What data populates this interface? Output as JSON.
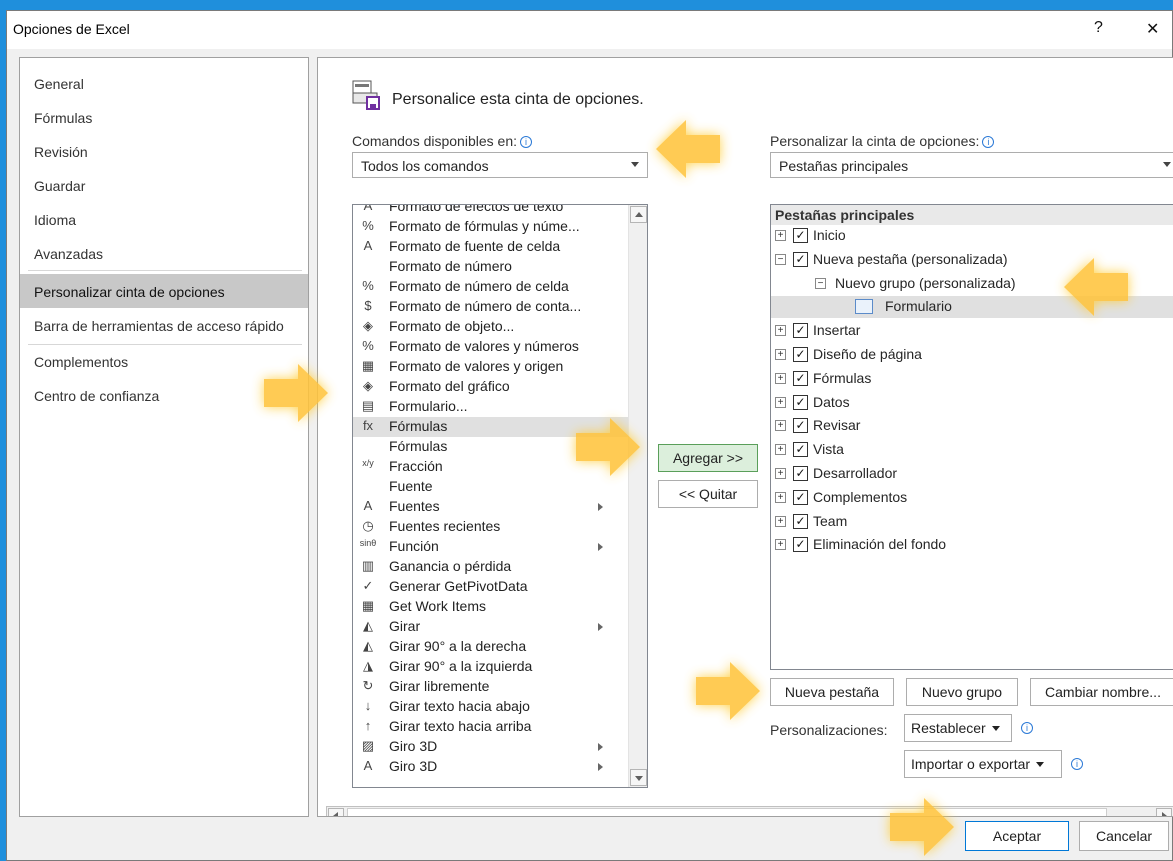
{
  "window": {
    "title": "Opciones de Excel",
    "help": "?",
    "close": "✕"
  },
  "sidebar": {
    "items": [
      {
        "label": "General"
      },
      {
        "label": "Fórmulas"
      },
      {
        "label": "Revisión"
      },
      {
        "label": "Guardar"
      },
      {
        "label": "Idioma"
      },
      {
        "label": "Avanzadas"
      },
      {
        "label": "Personalizar cinta de opciones"
      },
      {
        "label": "Barra de herramientas de acceso rápido"
      },
      {
        "label": "Complementos"
      },
      {
        "label": "Centro de confianza"
      }
    ],
    "selected_index": 6
  },
  "main": {
    "heading": "Personalice esta cinta de opciones.",
    "commands_label": "Comandos disponibles en:",
    "commands_value": "Todos los comandos",
    "ribbon_label": "Personalizar la cinta de opciones:",
    "ribbon_value": "Pestañas principales",
    "commands": [
      {
        "label": "Formato de efectos de texto",
        "icon": "A"
      },
      {
        "label": "Formato de fórmulas y núme...",
        "icon": "%"
      },
      {
        "label": "Formato de fuente de celda",
        "icon": "A"
      },
      {
        "label": "Formato de número",
        "icon": ""
      },
      {
        "label": "Formato de número de celda",
        "icon": "%"
      },
      {
        "label": "Formato de número de conta...",
        "icon": "$"
      },
      {
        "label": "Formato de objeto...",
        "icon": "◈"
      },
      {
        "label": "Formato de valores y números",
        "icon": "%"
      },
      {
        "label": "Formato de valores y origen",
        "icon": "▦"
      },
      {
        "label": "Formato del gráfico",
        "icon": "◈"
      },
      {
        "label": "Formulario...",
        "icon": "▤"
      },
      {
        "label": "Fórmulas",
        "icon": "fx"
      },
      {
        "label": "Fórmulas",
        "icon": ""
      },
      {
        "label": "Fracción",
        "icon": "x/y"
      },
      {
        "label": "Fuente",
        "icon": ""
      },
      {
        "label": "Fuentes",
        "icon": "A"
      },
      {
        "label": "Fuentes recientes",
        "icon": "◷"
      },
      {
        "label": "Función",
        "icon": "sinθ"
      },
      {
        "label": "Ganancia o pérdida",
        "icon": "▥"
      },
      {
        "label": "Generar GetPivotData",
        "icon": "✓"
      },
      {
        "label": "Get Work Items",
        "icon": "▦"
      },
      {
        "label": "Girar",
        "icon": "◭"
      },
      {
        "label": "Girar 90° a la derecha",
        "icon": "◭"
      },
      {
        "label": "Girar 90° a la izquierda",
        "icon": "◮"
      },
      {
        "label": "Girar libremente",
        "icon": "↻"
      },
      {
        "label": "Girar texto hacia abajo",
        "icon": "↓"
      },
      {
        "label": "Girar texto hacia arriba",
        "icon": "↑"
      },
      {
        "label": "Giro 3D",
        "icon": "▨"
      },
      {
        "label": "Giro 3D",
        "icon": "A"
      }
    ],
    "add_button": "Agregar >>",
    "remove_button": "<< Quitar",
    "tree": {
      "header": "Pestañas principales",
      "items": [
        {
          "label": "Inicio",
          "expander": "+",
          "checked": true,
          "level": 0
        },
        {
          "label": "Nueva pestaña (personalizada)",
          "expander": "−",
          "checked": true,
          "level": 0
        },
        {
          "label": "Nuevo grupo (personalizada)",
          "expander": "−",
          "checked": false,
          "level": 1
        },
        {
          "label": "Formulario",
          "expander": "",
          "checked": false,
          "level": 2
        },
        {
          "label": "Insertar",
          "expander": "+",
          "checked": true,
          "level": 0
        },
        {
          "label": "Diseño de página",
          "expander": "+",
          "checked": true,
          "level": 0
        },
        {
          "label": "Fórmulas",
          "expander": "+",
          "checked": true,
          "level": 0
        },
        {
          "label": "Datos",
          "expander": "+",
          "checked": true,
          "level": 0
        },
        {
          "label": "Revisar",
          "expander": "+",
          "checked": true,
          "level": 0
        },
        {
          "label": "Vista",
          "expander": "+",
          "checked": true,
          "level": 0
        },
        {
          "label": "Desarrollador",
          "expander": "+",
          "checked": true,
          "level": 0
        },
        {
          "label": "Complementos",
          "expander": "+",
          "checked": true,
          "level": 0
        },
        {
          "label": "Team",
          "expander": "+",
          "checked": true,
          "level": 0
        },
        {
          "label": "Eliminación del fondo",
          "expander": "+",
          "checked": true,
          "level": 0
        }
      ]
    },
    "new_tab_button": "Nueva pestaña",
    "new_group_button": "Nuevo grupo",
    "rename_button": "Cambiar nombre...",
    "customizations_label": "Personalizaciones:",
    "reset_button": "Restablecer",
    "import_export_button": "Importar o exportar"
  },
  "footer": {
    "ok_button": "Aceptar",
    "cancel_button": "Cancelar"
  },
  "colors": {
    "selection": "#c8c8c8",
    "default_button": "#dcefdc",
    "arrow": "#ffc43d"
  }
}
